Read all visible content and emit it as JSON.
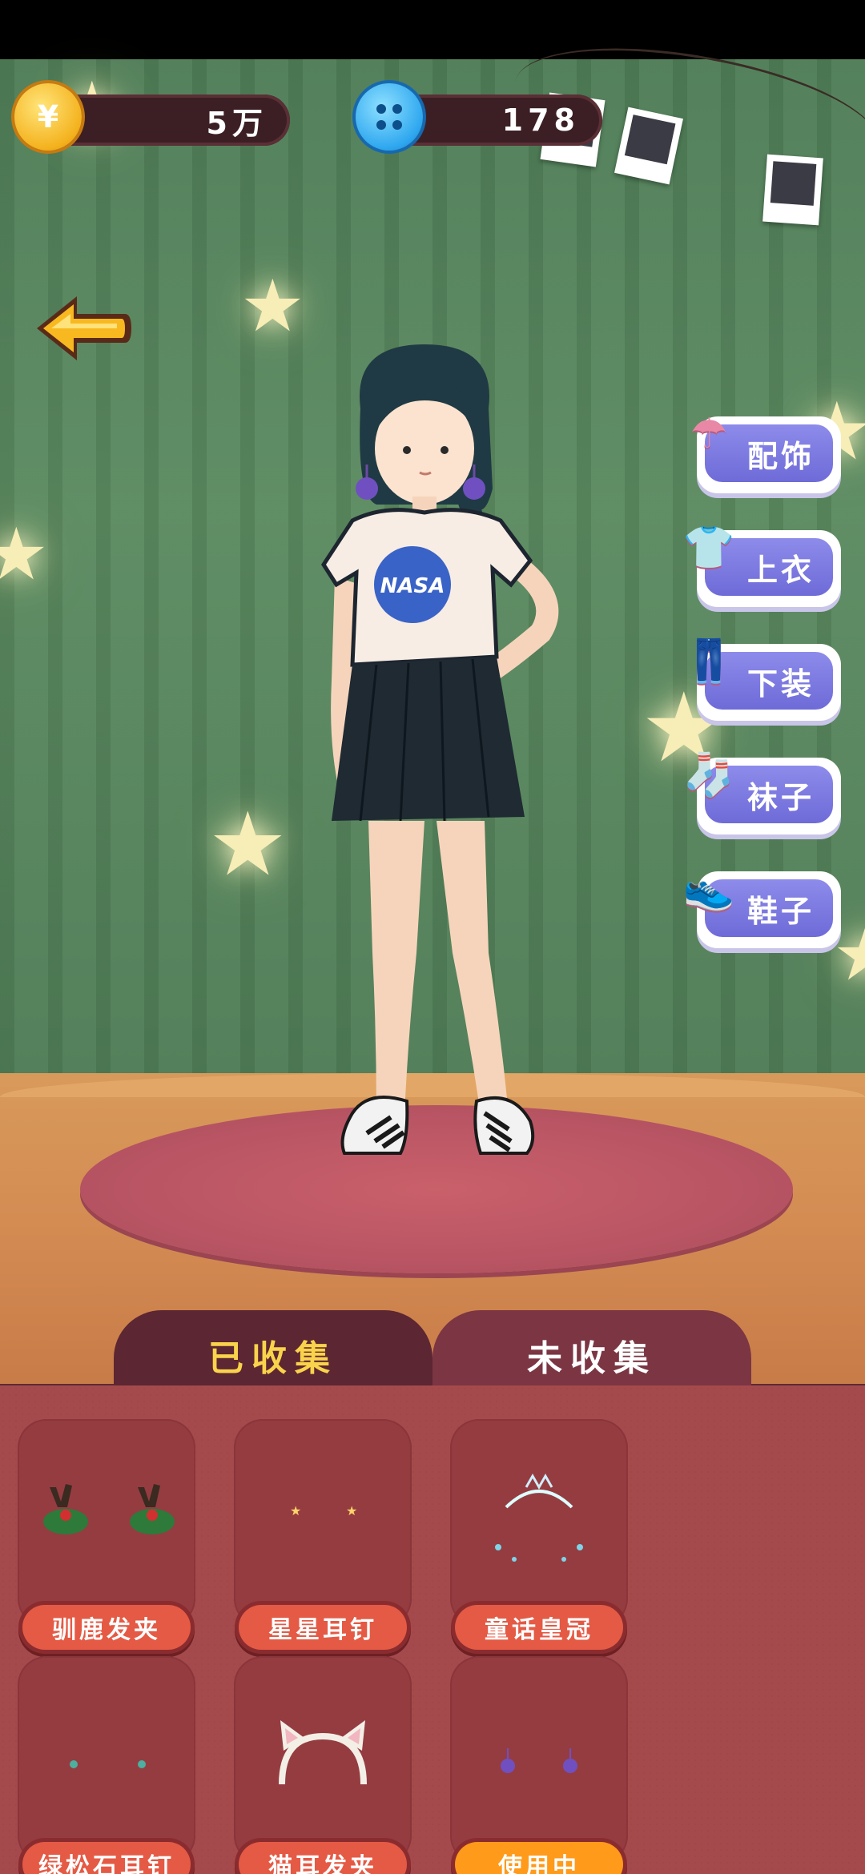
{
  "currency": {
    "coins": "5万",
    "coin_symbol": "¥",
    "buttons": "178"
  },
  "categories": [
    {
      "label": "配饰",
      "icon": "hat-icon"
    },
    {
      "label": "上衣",
      "icon": "shirt-icon"
    },
    {
      "label": "下装",
      "icon": "pants-icon"
    },
    {
      "label": "袜子",
      "icon": "sock-icon"
    },
    {
      "label": "鞋子",
      "icon": "shoe-icon"
    }
  ],
  "tabs": {
    "collected": "已收集",
    "uncollected": "未收集"
  },
  "items": [
    {
      "label": "驯鹿发夹",
      "state": "default"
    },
    {
      "label": "星星耳钉",
      "state": "default"
    },
    {
      "label": "童话皇冠",
      "state": "default"
    },
    {
      "label": "绿松石耳钉",
      "state": "default"
    },
    {
      "label": "猫耳发夹",
      "state": "default"
    },
    {
      "label": "使用中",
      "state": "in-use"
    }
  ],
  "shirt_print": "NASA",
  "colors": {
    "accent_tab_text": "#f9d34b",
    "category_button": "#7c79e0",
    "item_label": "#e45a45",
    "item_label_active": "#ff9a1a"
  }
}
